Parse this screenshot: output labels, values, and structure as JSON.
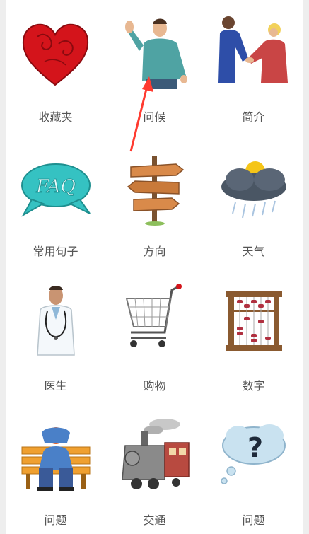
{
  "grid": {
    "items": [
      {
        "label": "收藏夹",
        "icon": "heart-icon"
      },
      {
        "label": "问候",
        "icon": "waving-man-icon"
      },
      {
        "label": "简介",
        "icon": "handshake-icon"
      },
      {
        "label": "常用句子",
        "icon": "faq-bubble-icon"
      },
      {
        "label": "方向",
        "icon": "signpost-icon"
      },
      {
        "label": "天气",
        "icon": "storm-cloud-icon"
      },
      {
        "label": "医生",
        "icon": "doctor-icon"
      },
      {
        "label": "购物",
        "icon": "shopping-cart-icon"
      },
      {
        "label": "数字",
        "icon": "abacus-icon"
      },
      {
        "label": "问题",
        "icon": "stressed-person-icon"
      },
      {
        "label": "交通",
        "icon": "train-icon"
      },
      {
        "label": "问题",
        "icon": "question-cloud-icon"
      }
    ],
    "faq_text": "FAQ",
    "question_mark": "?"
  },
  "colors": {
    "annotation_arrow": "#ff3b30",
    "label_text": "#555555"
  }
}
